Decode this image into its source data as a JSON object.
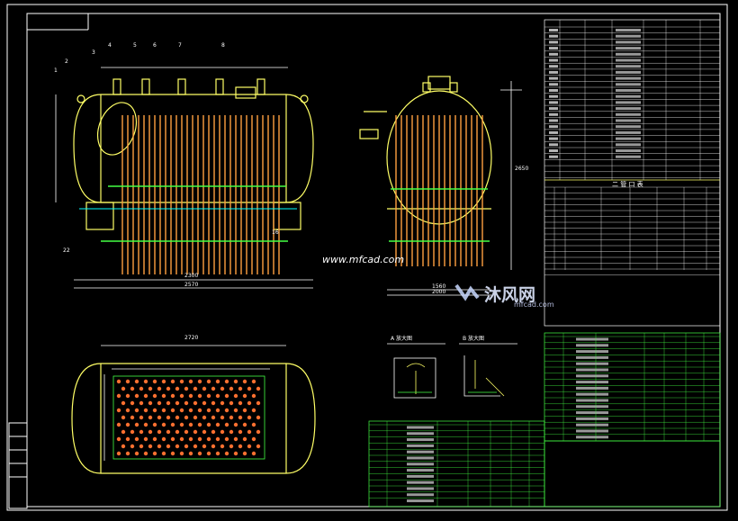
{
  "watermark": {
    "site": "www.mfcad.com",
    "brand": "沐风网",
    "brand_sub": "mfcad.com"
  },
  "drawing": {
    "dim_overall_length": "2570",
    "dim_inner_length": "2300",
    "dim_side_width": "1560",
    "dim_side_height": "2000",
    "dim_top_length": "2720",
    "dim_right_height": "2650",
    "detail_a_title": "A 放大图",
    "detail_b_title": "B 放大图",
    "section_title": "二 管 口 表"
  },
  "colors": {
    "background": "#000000",
    "frame": "#ffffff",
    "vessel": "#ffff66",
    "tubes": "#ffa040",
    "dims": "#ffffff",
    "table_lines": "#44ff44",
    "text": "#ffffff",
    "accent_cyan": "#00ffff",
    "accent_red": "#ff3030"
  }
}
